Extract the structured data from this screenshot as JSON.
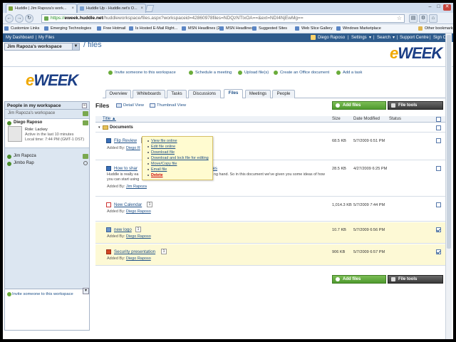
{
  "browser": {
    "tabs": [
      {
        "label": "Huddle | Jim Rapoza's work..."
      },
      {
        "label": "Huddle Up - Huddle.net's O..."
      }
    ],
    "url": {
      "scheme": "https://",
      "domain": "eweek.huddle.net",
      "path": "/huddleworkspace/files.aspx?workspaceid=42860978files=NDQzNTIxOA==&ext=NDI4NjEwMg=="
    },
    "nav": {
      "back": "←",
      "forward": "→",
      "reload": "↻",
      "home": "⌂"
    },
    "window_buttons": {
      "min": "–",
      "max": "□",
      "close": "✕"
    },
    "bookmarks": [
      "Customize Links",
      "Emerging Technologies",
      "Free Hotmail",
      "Is Hosted E-Mail Right...",
      "MSN Headlines (2)",
      "MSN Headlines",
      "Suggested Sites",
      "Web Slice Gallery",
      "Windows Marketplace"
    ],
    "other_bookmarks": "Other bookmarks"
  },
  "topbar": {
    "left": [
      "My Dashboard",
      "My Files"
    ],
    "user": "Diego Raposo",
    "right": [
      "Settings",
      "Search",
      "Support Centre",
      "Sign Out"
    ]
  },
  "header": {
    "workspace": "Jim Rapoza's workspace",
    "crumb": "/ files",
    "logo_e": "e",
    "logo_rest": "WEEK"
  },
  "actions": [
    "Invite someone to this workspace",
    "Schedule a meeting",
    "Upload file(s)",
    "Create an Office document",
    "Add a task"
  ],
  "tabs": [
    "Overview",
    "Whiteboards",
    "Tasks",
    "Discussions",
    "Files",
    "Meetings",
    "People"
  ],
  "active_tab": "Files",
  "sidebar": {
    "title": "People in my workspace",
    "owner_label": "Jim Rapoza's workspace",
    "current_user": {
      "name": "Diego Raposo",
      "role": "Role: Lackey",
      "activity": "Active in the last 10 minutes",
      "local_time": "Local time: 7:44 PM (GMT-1 DST)"
    },
    "members": [
      "Jim Rapoza",
      "Jimbo Rap"
    ],
    "invite": "Invite someone to this workspace"
  },
  "files": {
    "title": "Files",
    "detail_view": "Detail View",
    "thumbnail_view": "Thumbnail View",
    "add_files": "Add files",
    "file_tools": "File tools",
    "columns": {
      "title": "Title ▲",
      "size": "Size",
      "date": "Date Modified",
      "status": "Status"
    },
    "folder": "Documents",
    "rows": [
      {
        "name": "Flip Review",
        "added_label": "Added By:",
        "added_by": "Diego R",
        "size": "68.5 KB",
        "date": "5/7/2009 6:51 PM",
        "checked": false,
        "highlight": false
      },
      {
        "name": "How to shar",
        "name_tail": "files",
        "desc1": "Huddle is really ea",
        "desc1_tail": "ng hand. So in this document we've given you some ideas of how",
        "desc2": "you can start using",
        "added_label": "Added By:",
        "added_by": "Jim Rapoza",
        "size": "28.5 KB",
        "date": "4/27/2009 6:25 PM",
        "checked": false,
        "highlight": false
      },
      {
        "name": "New Calendar",
        "version": "1",
        "added_label": "Added By:",
        "added_by": "Diego Raposo",
        "size": "1,014.3 KB",
        "date": "5/7/2009 7:44 PM",
        "checked": false,
        "highlight": false
      },
      {
        "name": "new logo",
        "version": "1",
        "added_label": "Added By:",
        "added_by": "Diego Raposo",
        "size": "10.7 KB",
        "date": "5/7/2009 6:56 PM",
        "checked": true,
        "highlight": true
      },
      {
        "name": "Security presentation",
        "version": "1",
        "added_label": "Added By:",
        "added_by": "Diego Raposo",
        "size": "906 KB",
        "date": "5/7/2009 6:57 PM",
        "checked": true,
        "highlight": true
      }
    ],
    "popup": [
      "View file online",
      "Edit file online",
      "Download file",
      "Download and lock file for editing",
      "Move/Copy file",
      "Email file",
      "Delete"
    ]
  },
  "colors": {
    "topbar": "#2e5b8c",
    "link": "#1d4f87",
    "green": "#4f9a2e",
    "highlight": "#fdf9d5"
  }
}
